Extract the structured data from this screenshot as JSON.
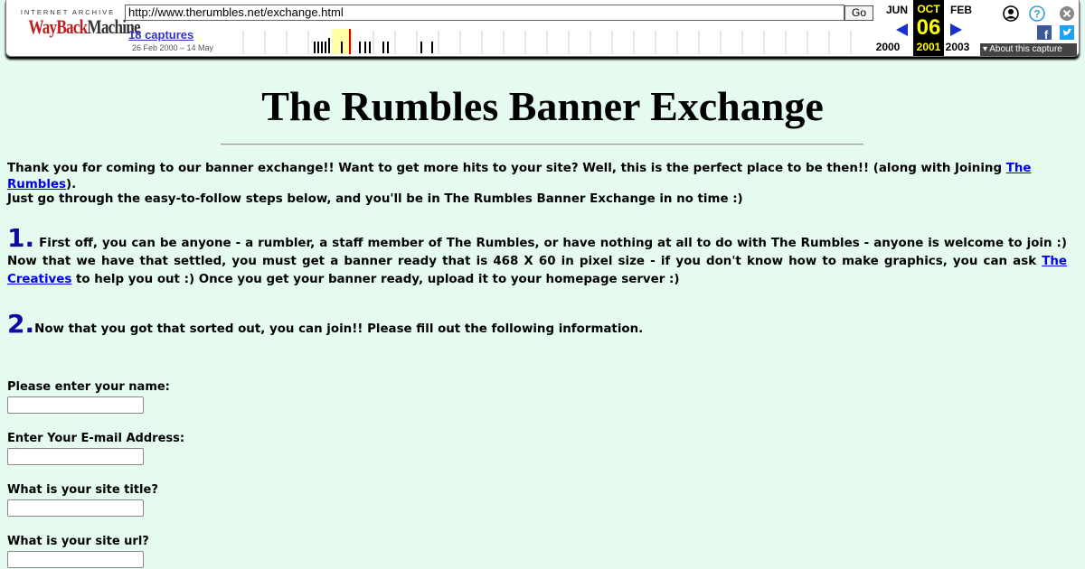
{
  "wayback": {
    "logo_top": "INTERNET ARCHIVE",
    "logo_wb": "WayBack",
    "logo_m": "Machine",
    "url": "http://www.therumbles.net/exchange.html",
    "go_label": "Go",
    "captures": "18 captures",
    "range": "26 Feb 2000 – 14 May",
    "prev_month": "JUN",
    "cur_month": "OCT",
    "next_month": "FEB",
    "cur_day": "06",
    "prev_year": "2000",
    "cur_year": "2001",
    "next_year": "2003",
    "about": "About this capture",
    "colors": {
      "highlight": "#ffff00",
      "link": "#3333cc"
    },
    "icons": [
      "user-icon",
      "help-icon",
      "close-icon",
      "facebook-icon",
      "twitter-icon",
      "prev-arrow-icon",
      "next-arrow-icon"
    ]
  },
  "page": {
    "title": "The Rumbles Banner Exchange",
    "intro_1": "Thank you for coming to our banner exchange!! Want to get more hits to your site? Well, this is the perfect place to be then!! (along with Joining ",
    "intro_1_link": "The Rumbles",
    "intro_1_end": ").",
    "intro_2": "Just go through the easy-to-follow steps below, and you'll be in The Rumbles Banner Exchange in no time :)",
    "step1_num": "1.",
    "step1_text": "First off, you can be anyone - a rumbler, a staff member of The Rumbles, or have nothing at all to do with The Rumbles - anyone is welcome to join :) Now that we have that settled, you must get a banner ready that is 468 X 60 in pixel size - if you don't know how to make graphics, you can ask ",
    "step1_link": "The Creatives",
    "step1_end": " to help you out :) Once you get your banner ready, upload it to your homepage server :)",
    "step2_num": "2.",
    "step2_text": "Now that you got that sorted out, you can join!! Please fill out the following information.",
    "form": {
      "name_label": "Please enter your name:",
      "email_label": "Enter Your E-mail Address:",
      "title_label": "What is your site title?",
      "url_label": "What is your site url?"
    }
  }
}
